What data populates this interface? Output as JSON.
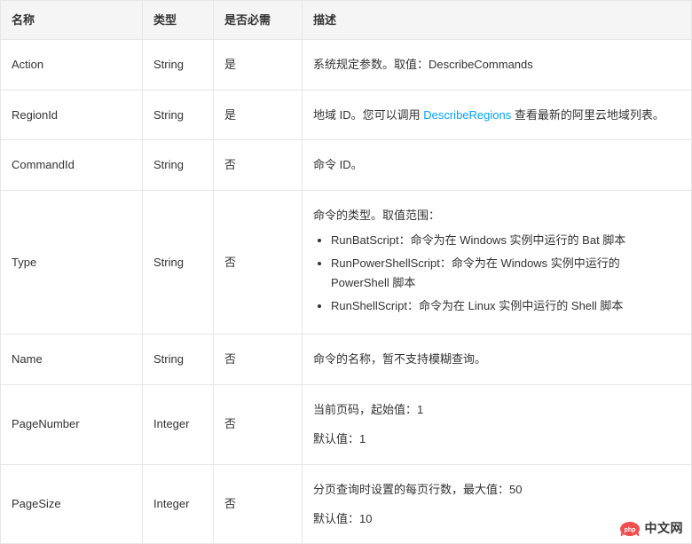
{
  "headers": {
    "name": "名称",
    "type": "类型",
    "required": "是否必需",
    "desc": "描述"
  },
  "rows": [
    {
      "name": "Action",
      "type": "String",
      "required": "是",
      "desc_prefix": "系统规定参数。取值：DescribeCommands"
    },
    {
      "name": "RegionId",
      "type": "String",
      "required": "是",
      "desc_prefix": "地域 ID。您可以调用 ",
      "link_text": "DescribeRegions",
      "desc_suffix": " 查看最新的阿里云地域列表。"
    },
    {
      "name": "CommandId",
      "type": "String",
      "required": "否",
      "desc_prefix": "命令 ID。"
    },
    {
      "name": "Type",
      "type": "String",
      "required": "否",
      "desc_prefix": "命令的类型。取值范围：",
      "list": [
        "RunBatScript：命令为在 Windows 实例中运行的 Bat 脚本",
        "RunPowerShellScript：命令为在 Windows 实例中运行的 PowerShell 脚本",
        "RunShellScript：命令为在 Linux 实例中运行的 Shell 脚本"
      ]
    },
    {
      "name": "Name",
      "type": "String",
      "required": "否",
      "desc_prefix": "命令的名称，暂不支持模糊查询。"
    },
    {
      "name": "PageNumber",
      "type": "Integer",
      "required": "否",
      "lines": [
        "当前页码，起始值：1",
        "默认值：1"
      ]
    },
    {
      "name": "PageSize",
      "type": "Integer",
      "required": "否",
      "lines": [
        "分页查询时设置的每页行数，最大值：50",
        "默认值：10"
      ]
    }
  ],
  "logo": {
    "text": "中文网",
    "brand": "php"
  }
}
